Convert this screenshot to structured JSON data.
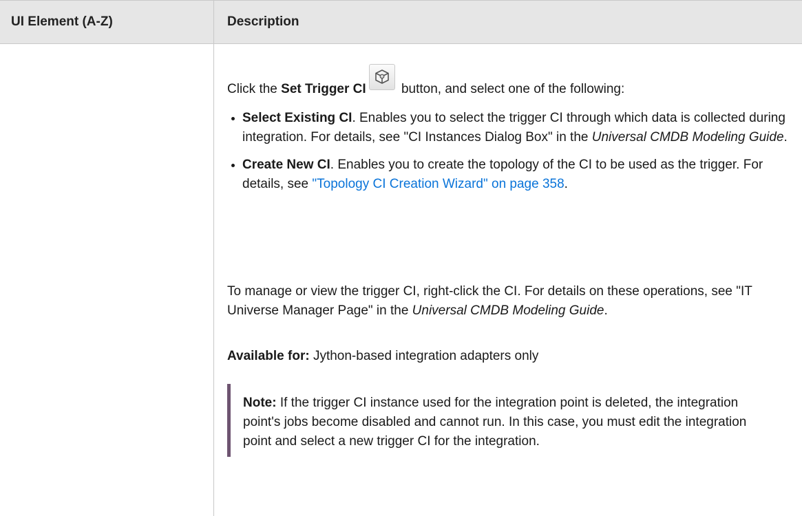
{
  "table": {
    "headers": {
      "col1": "UI Element (A-Z)",
      "col2": "Description"
    }
  },
  "intro": {
    "prefix": "Click the ",
    "button_name": "Set Trigger CI",
    "button_icon": "cube-icon",
    "suffix": " button, and select one of the following:"
  },
  "bullets": [
    {
      "title": "Select Existing CI",
      "text_before": ". Enables you to select the trigger CI through which data is collected during integration. For details, see \"CI Instances Dialog Box\" in the ",
      "guide": "Universal CMDB Modeling Guide",
      "text_after": "."
    },
    {
      "title": "Create New CI",
      "text_before": ". Enables you to create the topology of the CI to be used as the trigger. For details, see ",
      "link": "\"Topology CI Creation Wizard\" on page 358",
      "text_after": "."
    }
  ],
  "manage": {
    "text_before": "To manage or view the trigger CI, right-click the CI. For details on these operations, see \"IT Universe Manager Page\" in the ",
    "guide": "Universal CMDB Modeling Guide",
    "text_after": "."
  },
  "available": {
    "label": "Available for:",
    "text": " Jython-based integration adapters only"
  },
  "note": {
    "label": "Note:",
    "text": "  If the trigger CI instance used for the integration point is deleted, the integration point's jobs become disabled and cannot run. In this case, you must edit the integration point and select a new trigger CI for the integration."
  },
  "colors": {
    "header_bg": "#e6e6e6",
    "link": "#0a74d9",
    "note_bar": "#6e5471"
  }
}
